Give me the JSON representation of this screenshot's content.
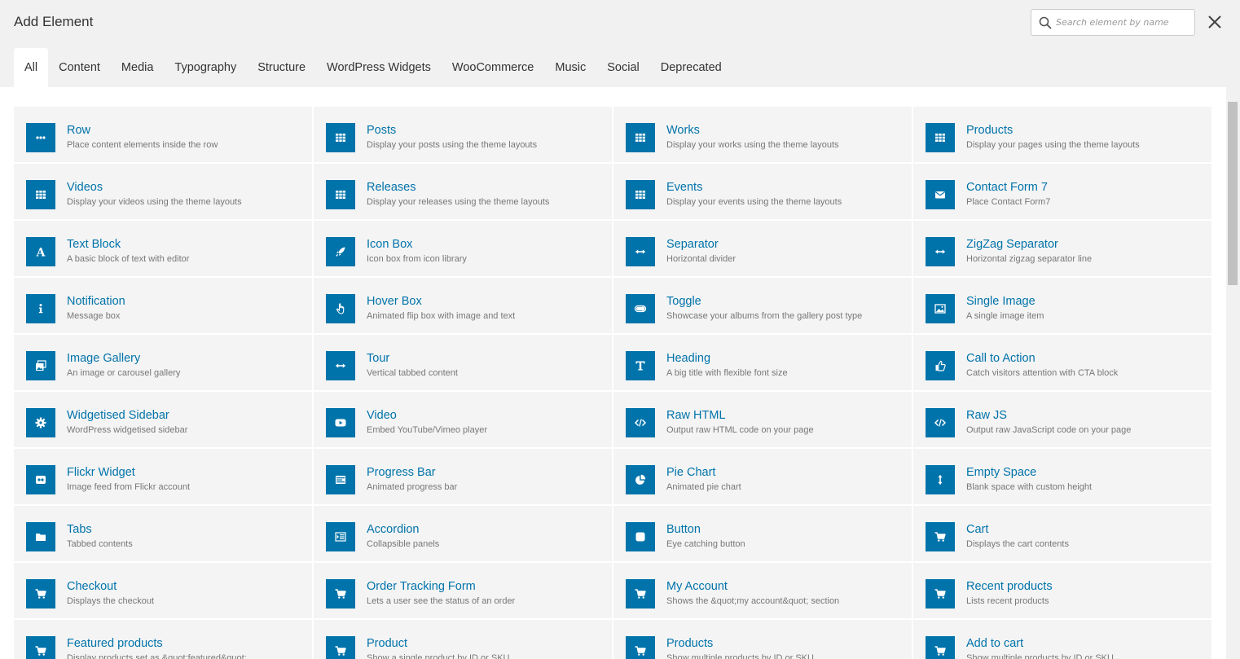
{
  "header": {
    "title": "Add Element",
    "search_placeholder": "Search element by name",
    "search_value": ""
  },
  "tabs": [
    {
      "label": "All",
      "active": true
    },
    {
      "label": "Content",
      "active": false
    },
    {
      "label": "Media",
      "active": false
    },
    {
      "label": "Typography",
      "active": false
    },
    {
      "label": "Structure",
      "active": false
    },
    {
      "label": "WordPress Widgets",
      "active": false
    },
    {
      "label": "WooCommerce",
      "active": false
    },
    {
      "label": "Music",
      "active": false
    },
    {
      "label": "Social",
      "active": false
    },
    {
      "label": "Deprecated",
      "active": false
    }
  ],
  "colors": {
    "accent": "#0073aa",
    "tile_bg": "#f4f4f4",
    "muted_text": "#777777"
  },
  "elements": [
    {
      "name": "Row",
      "desc": "Place content elements inside the row",
      "icon": "dots-icon"
    },
    {
      "name": "Posts",
      "desc": "Display your posts using the theme layouts",
      "icon": "grid-icon"
    },
    {
      "name": "Works",
      "desc": "Display your works using the theme layouts",
      "icon": "grid-icon"
    },
    {
      "name": "Products",
      "desc": "Display your pages using the theme layouts",
      "icon": "grid-icon"
    },
    {
      "name": "Videos",
      "desc": "Display your videos using the theme layouts",
      "icon": "grid-icon"
    },
    {
      "name": "Releases",
      "desc": "Display your releases using the theme layouts",
      "icon": "grid-icon"
    },
    {
      "name": "Events",
      "desc": "Display your events using the theme layouts",
      "icon": "grid-icon"
    },
    {
      "name": "Contact Form 7",
      "desc": "Place Contact Form7",
      "icon": "envelope-icon"
    },
    {
      "name": "Text Block",
      "desc": "A basic block of text with editor",
      "icon": "letter-a-icon"
    },
    {
      "name": "Icon Box",
      "desc": "Icon box from icon library",
      "icon": "rocket-icon"
    },
    {
      "name": "Separator",
      "desc": "Horizontal divider",
      "icon": "arrows-horizontal-icon"
    },
    {
      "name": "ZigZag Separator",
      "desc": "Horizontal zigzag separator line",
      "icon": "arrows-horizontal-icon"
    },
    {
      "name": "Notification",
      "desc": "Message box",
      "icon": "info-icon"
    },
    {
      "name": "Hover Box",
      "desc": "Animated flip box with image and text",
      "icon": "hand-pointer-icon"
    },
    {
      "name": "Toggle",
      "desc": "Showcase your albums from the gallery post type",
      "icon": "toggle-icon"
    },
    {
      "name": "Single Image",
      "desc": "A single image item",
      "icon": "image-icon"
    },
    {
      "name": "Image Gallery",
      "desc": "An image or carousel gallery",
      "icon": "gallery-icon"
    },
    {
      "name": "Tour",
      "desc": "Vertical tabbed content",
      "icon": "arrows-horizontal-icon"
    },
    {
      "name": "Heading",
      "desc": "A big title with flexible font size",
      "icon": "heading-icon"
    },
    {
      "name": "Call to Action",
      "desc": "Catch visitors attention with CTA block",
      "icon": "thumbs-up-icon"
    },
    {
      "name": "Widgetised Sidebar",
      "desc": "WordPress widgetised sidebar",
      "icon": "gear-icon"
    },
    {
      "name": "Video",
      "desc": "Embed YouTube/Vimeo player",
      "icon": "play-icon"
    },
    {
      "name": "Raw HTML",
      "desc": "Output raw HTML code on your page",
      "icon": "code-icon"
    },
    {
      "name": "Raw JS",
      "desc": "Output raw JavaScript code on your page",
      "icon": "code-icon"
    },
    {
      "name": "Flickr Widget",
      "desc": "Image feed from Flickr account",
      "icon": "flickr-icon"
    },
    {
      "name": "Progress Bar",
      "desc": "Animated progress bar",
      "icon": "progress-icon"
    },
    {
      "name": "Pie Chart",
      "desc": "Animated pie chart",
      "icon": "pie-chart-icon"
    },
    {
      "name": "Empty Space",
      "desc": "Blank space with custom height",
      "icon": "arrows-vertical-icon"
    },
    {
      "name": "Tabs",
      "desc": "Tabbed contents",
      "icon": "folder-icon"
    },
    {
      "name": "Accordion",
      "desc": "Collapsible panels",
      "icon": "accordion-icon"
    },
    {
      "name": "Button",
      "desc": "Eye catching button",
      "icon": "button-icon"
    },
    {
      "name": "Cart",
      "desc": "Displays the cart contents",
      "icon": "cart-icon"
    },
    {
      "name": "Checkout",
      "desc": "Displays the checkout",
      "icon": "cart-icon"
    },
    {
      "name": "Order Tracking Form",
      "desc": "Lets a user see the status of an order",
      "icon": "cart-icon"
    },
    {
      "name": "My Account",
      "desc": "Shows the &quot;my account&quot; section",
      "icon": "cart-icon"
    },
    {
      "name": "Recent products",
      "desc": "Lists recent products",
      "icon": "cart-icon"
    },
    {
      "name": "Featured products",
      "desc": "Display products set as &quot;featured&quot;",
      "icon": "cart-icon"
    },
    {
      "name": "Product",
      "desc": "Show a single product by ID or SKU",
      "icon": "cart-icon"
    },
    {
      "name": "Products",
      "desc": "Show multiple products by ID or SKU",
      "icon": "cart-icon"
    },
    {
      "name": "Add to cart",
      "desc": "Show multiple products by ID or SKU",
      "icon": "cart-icon"
    }
  ]
}
